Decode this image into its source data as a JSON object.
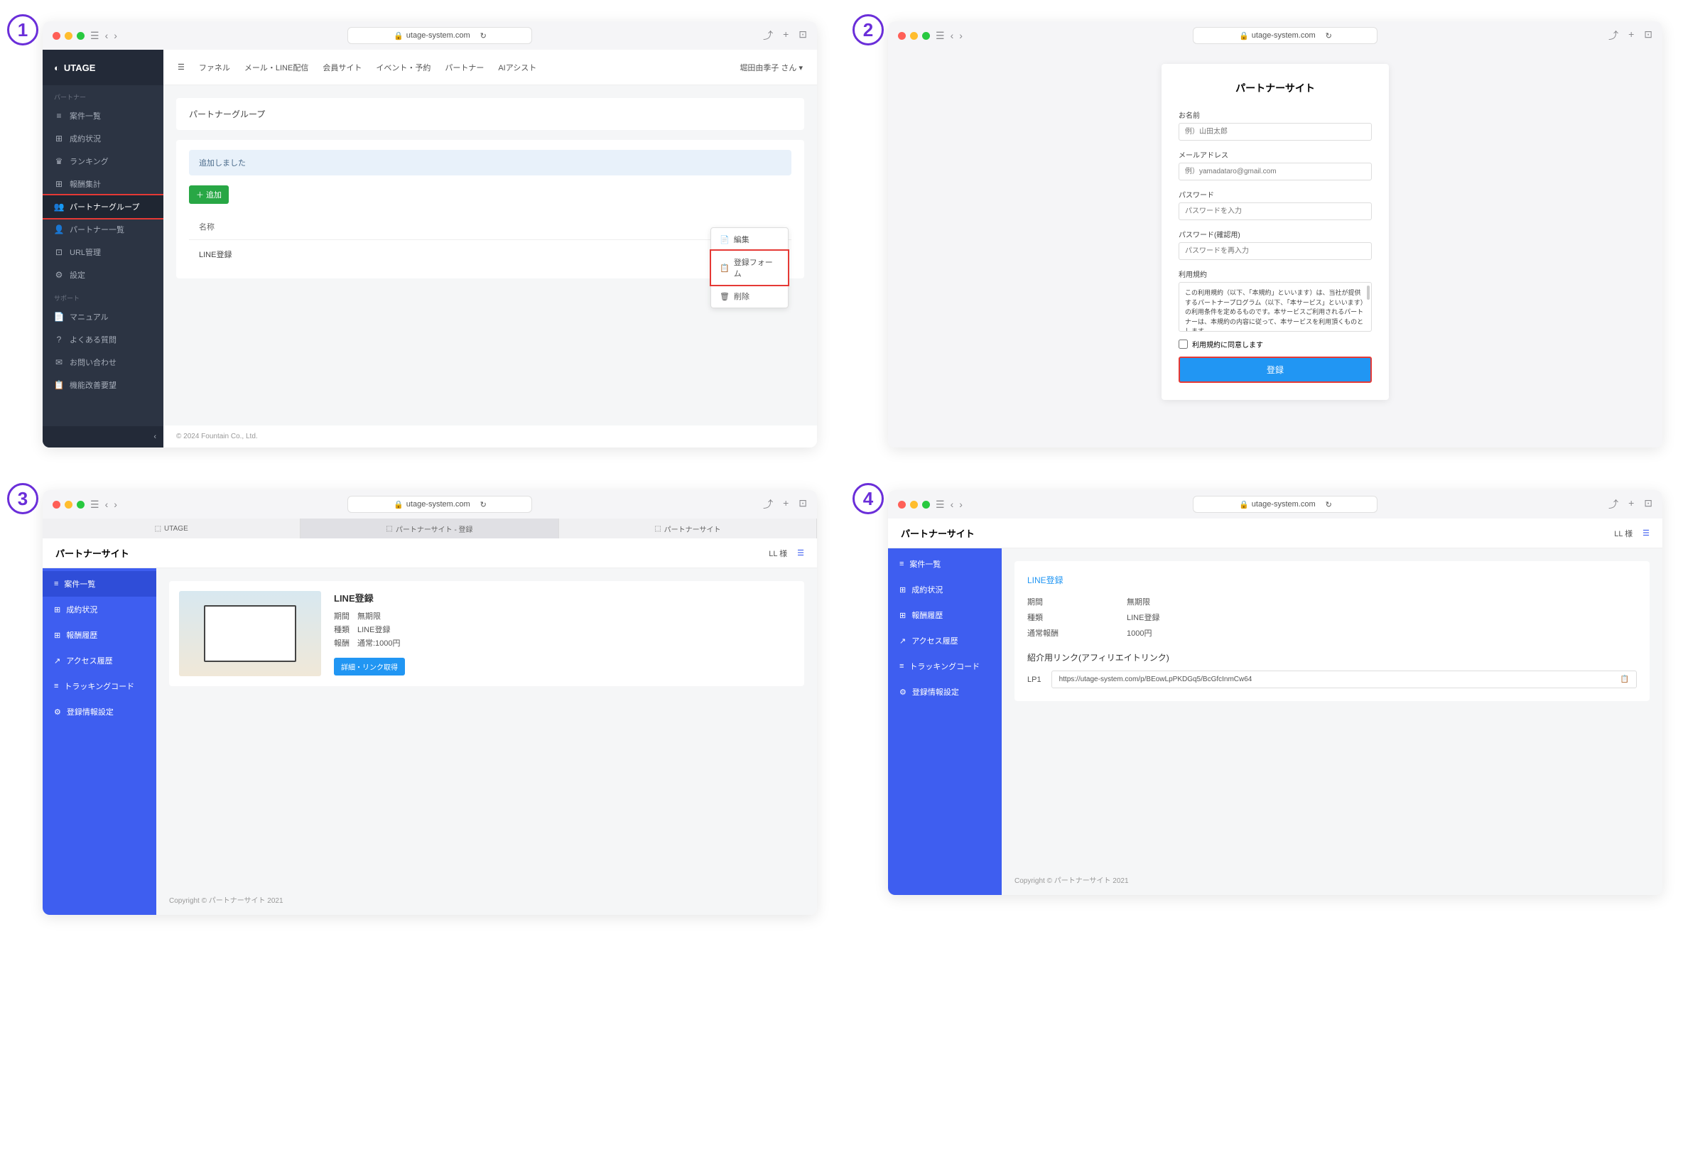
{
  "url": "utage-system.com",
  "screen1": {
    "logo": "UTAGE",
    "sideHeader1": "パートナー",
    "sideHeader2": "サポート",
    "nav": [
      {
        "icon": "≡",
        "label": "案件一覧"
      },
      {
        "icon": "⊞",
        "label": "成約状況"
      },
      {
        "icon": "♛",
        "label": "ランキング"
      },
      {
        "icon": "⊞",
        "label": "報酬集計"
      },
      {
        "icon": "👥",
        "label": "パートナーグループ"
      },
      {
        "icon": "👤",
        "label": "パートナー一覧"
      },
      {
        "icon": "⊡",
        "label": "URL管理"
      },
      {
        "icon": "⚙",
        "label": "設定"
      }
    ],
    "support": [
      {
        "icon": "📄",
        "label": "マニュアル"
      },
      {
        "icon": "?",
        "label": "よくある質問"
      },
      {
        "icon": "✉",
        "label": "お問い合わせ"
      },
      {
        "icon": "📋",
        "label": "機能改善要望"
      }
    ],
    "topnav": [
      "ファネル",
      "メール・LINE配信",
      "会員サイト",
      "イベント・予約",
      "パートナー",
      "AIアシスト"
    ],
    "user": "堀田由季子 さん ▾",
    "cardTitle": "パートナーグループ",
    "alert": "追加しました",
    "addBtn": "＋ 追加",
    "colName": "名称",
    "rowName": "LINE登録",
    "menu": [
      {
        "icon": "📄",
        "label": "編集"
      },
      {
        "icon": "📋",
        "label": "登録フォーム"
      },
      {
        "icon": "🗑",
        "label": "削除"
      }
    ],
    "footer": "© 2024 Fountain Co., Ltd."
  },
  "screen2": {
    "title": "パートナーサイト",
    "fields": [
      {
        "label": "お名前",
        "ph": "例）山田太郎"
      },
      {
        "label": "メールアドレス",
        "ph": "例）yamadataro@gmail.com"
      },
      {
        "label": "パスワード",
        "ph": "パスワードを入力"
      },
      {
        "label": "パスワード(確認用)",
        "ph": "パスワードを再入力"
      }
    ],
    "termsLabel": "利用規約",
    "termsText": "この利用規約（以下、「本規約」といいます）は、当社が提供するパートナープログラム（以下、「本サービス」といいます）の利用条件を定めるものです。本サービスご利用されるパートナーは、本規約の内容に従って、本サービスを利用頂くものとします。",
    "agree": "利用規約に同意します",
    "submit": "登録"
  },
  "screen3": {
    "tabs": [
      "UTAGE",
      "パートナーサイト - 登録",
      "パートナーサイト"
    ],
    "header": "パートナーサイト",
    "user": "LL 様",
    "side": [
      {
        "icon": "≡",
        "label": "案件一覧"
      },
      {
        "icon": "⊞",
        "label": "成約状況"
      },
      {
        "icon": "⊞",
        "label": "報酬履歴"
      },
      {
        "icon": "↗",
        "label": "アクセス履歴"
      },
      {
        "icon": "≡",
        "label": "トラッキングコード"
      },
      {
        "icon": "⚙",
        "label": "登録情報設定"
      }
    ],
    "itemTitle": "LINE登録",
    "rows": [
      {
        "k": "期間",
        "v": "無期限"
      },
      {
        "k": "種類",
        "v": "LINE登録"
      },
      {
        "k": "報酬",
        "v": "通常:1000円"
      }
    ],
    "detailBtn": "詳細・リンク取得",
    "footer": "Copyright © パートナーサイト 2021"
  },
  "screen4": {
    "header": "パートナーサイト",
    "user": "LL 様",
    "title": "LINE登録",
    "rows": [
      {
        "k": "期間",
        "v": "無期限"
      },
      {
        "k": "種類",
        "v": "LINE登録"
      },
      {
        "k": "通常報酬",
        "v": "1000円"
      }
    ],
    "affTitle": "紹介用リンク(アフィリエイトリンク)",
    "linkLabel": "LP1",
    "linkUrl": "https://utage-system.com/p/BEowLpPKDGq5/BcGfcInmCw64",
    "footer": "Copyright © パートナーサイト 2021"
  }
}
